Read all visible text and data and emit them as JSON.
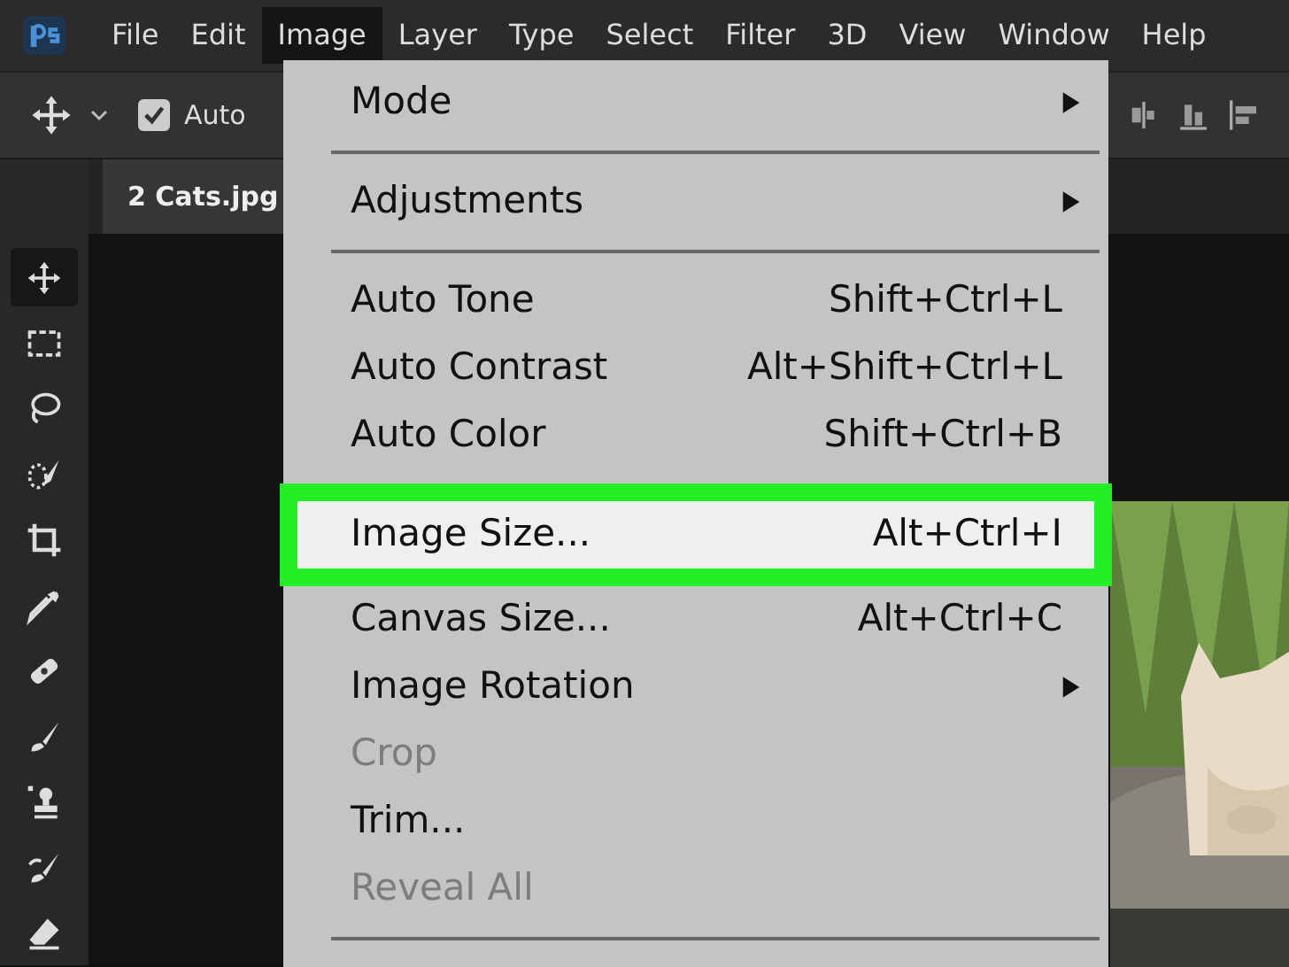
{
  "menubar": [
    {
      "label": "File",
      "selected": false
    },
    {
      "label": "Edit",
      "selected": false
    },
    {
      "label": "Image",
      "selected": true
    },
    {
      "label": "Layer",
      "selected": false
    },
    {
      "label": "Type",
      "selected": false
    },
    {
      "label": "Select",
      "selected": false
    },
    {
      "label": "Filter",
      "selected": false
    },
    {
      "label": "3D",
      "selected": false
    },
    {
      "label": "View",
      "selected": false
    },
    {
      "label": "Window",
      "selected": false
    },
    {
      "label": "Help",
      "selected": false
    }
  ],
  "options_bar": {
    "auto_select": {
      "label": "Auto",
      "checked": true
    }
  },
  "document_tab": {
    "title": "2 Cats.jpg"
  },
  "tools": [
    {
      "kind": "move",
      "selected": true
    },
    {
      "kind": "marquee",
      "selected": false
    },
    {
      "kind": "lasso",
      "selected": false
    },
    {
      "kind": "quick-select",
      "selected": false
    },
    {
      "kind": "crop",
      "selected": false
    },
    {
      "kind": "eyedropper",
      "selected": false
    },
    {
      "kind": "healing",
      "selected": false
    },
    {
      "kind": "brush",
      "selected": false
    },
    {
      "kind": "stamp",
      "selected": false
    },
    {
      "kind": "history-brush",
      "selected": false
    },
    {
      "kind": "eraser",
      "selected": false
    }
  ],
  "image_menu": [
    {
      "kind": "item",
      "label": "Mode",
      "submenu": true,
      "disabled": false,
      "selected": false
    },
    {
      "kind": "separator"
    },
    {
      "kind": "item",
      "label": "Adjustments",
      "submenu": true,
      "disabled": false,
      "selected": false
    },
    {
      "kind": "separator"
    },
    {
      "kind": "item",
      "label": "Auto Tone",
      "shortcut": "Shift+Ctrl+L",
      "submenu": false,
      "disabled": false,
      "selected": false
    },
    {
      "kind": "item",
      "label": "Auto Contrast",
      "shortcut": "Alt+Shift+Ctrl+L",
      "submenu": false,
      "disabled": false,
      "selected": false
    },
    {
      "kind": "item",
      "label": "Auto Color",
      "shortcut": "Shift+Ctrl+B",
      "submenu": false,
      "disabled": false,
      "selected": false
    },
    {
      "kind": "separator"
    },
    {
      "kind": "item",
      "label": "Image Size...",
      "shortcut": "Alt+Ctrl+I",
      "submenu": false,
      "disabled": false,
      "selected": true
    },
    {
      "kind": "item",
      "label": "Canvas Size...",
      "shortcut": "Alt+Ctrl+C",
      "submenu": false,
      "disabled": false,
      "selected": false
    },
    {
      "kind": "item",
      "label": "Image Rotation",
      "submenu": true,
      "disabled": false,
      "selected": false
    },
    {
      "kind": "item",
      "label": "Crop",
      "submenu": false,
      "disabled": true,
      "selected": false
    },
    {
      "kind": "item",
      "label": "Trim...",
      "submenu": false,
      "disabled": false,
      "selected": false
    },
    {
      "kind": "item",
      "label": "Reveal All",
      "submenu": false,
      "disabled": true,
      "selected": false
    },
    {
      "kind": "separator"
    }
  ]
}
